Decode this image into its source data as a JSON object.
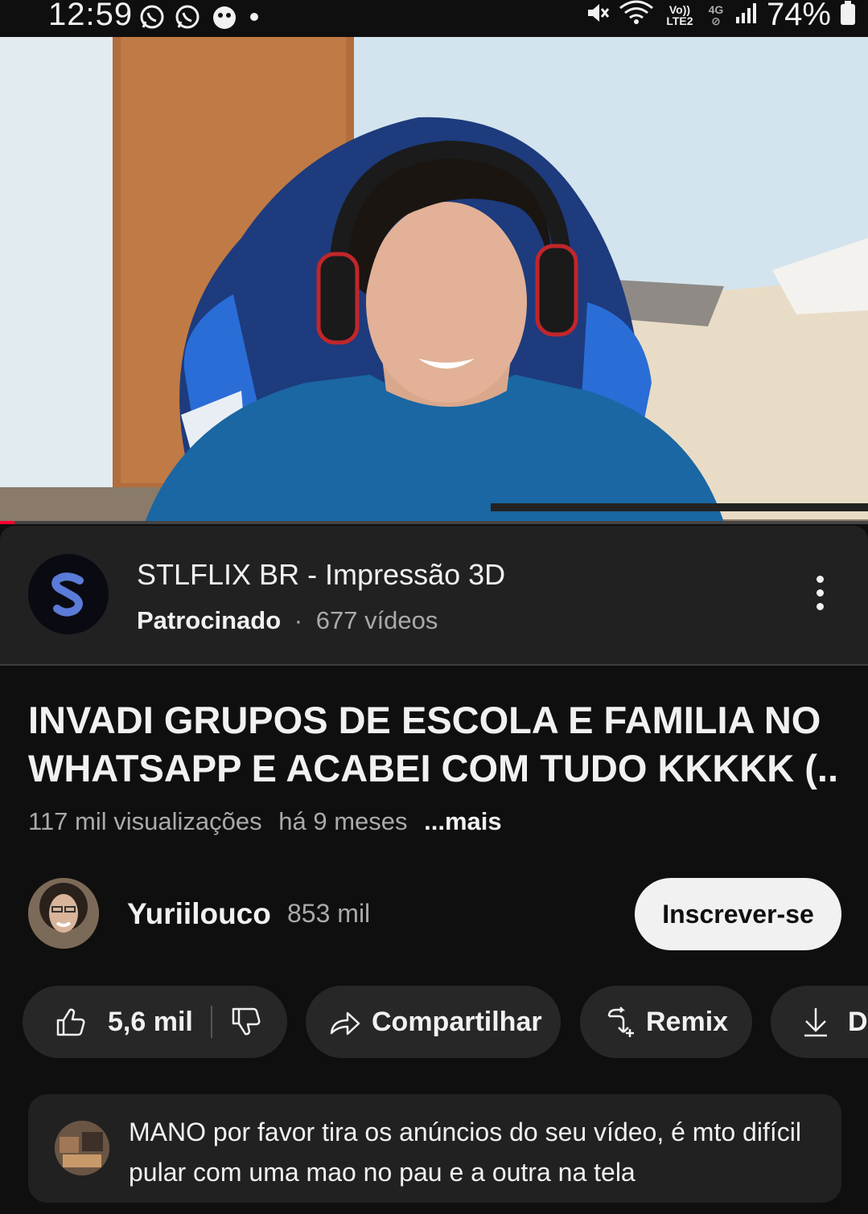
{
  "status_bar": {
    "time": "12:59",
    "battery": "74%",
    "network_top": "Vo))",
    "network_bottom": "LTE2",
    "network_4g": "4G",
    "icons": [
      "whatsapp-icon",
      "whatsapp-business-icon",
      "notification-icon",
      "dot-icon",
      "mute-icon",
      "wifi-icon",
      "signal-icon",
      "battery-icon"
    ]
  },
  "video": {
    "progress_fraction": 0.017
  },
  "ad": {
    "title": "STLFLIX BR - Impressão 3D",
    "sponsored": "Patrocinado",
    "separator": "·",
    "videos": "677 vídeos"
  },
  "video_info": {
    "title_line1": "INVADI GRUPOS DE ESCOLA E FAMILIA NO",
    "title_line2": "WHATSAPP E ACABEI COM TUDO KKKKK (..",
    "views": "117 mil visualizações",
    "age": "há 9 meses",
    "more": "...mais"
  },
  "channel": {
    "name": "Yuriilouco",
    "subscribers": "853 mil",
    "subscribe_label": "Inscrever-se"
  },
  "actions": {
    "likes": "5,6 mil",
    "share": "Compartilhar",
    "remix": "Remix",
    "download_partial": "D"
  },
  "comment": {
    "text": "MANO por favor tira os anúncios do seu vídeo, é mto difícil pular com uma mao no pau e a outra na tela"
  },
  "colors": {
    "background": "#0f0f0f",
    "card": "#212121",
    "pill": "#272727",
    "progress": "#ff0033"
  }
}
